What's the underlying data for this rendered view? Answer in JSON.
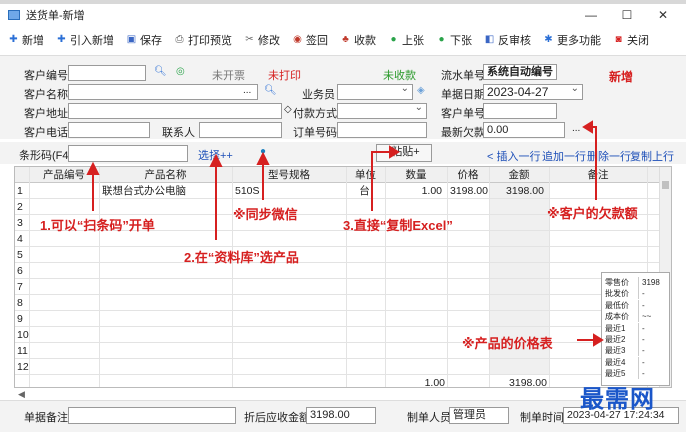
{
  "window": {
    "title": "送货单-新增"
  },
  "window_controls": {
    "minimize": "—",
    "maximize": "☐",
    "close": "✕"
  },
  "toolbar": [
    {
      "label": "新增",
      "icon": "plus-icon",
      "glyph": "✚",
      "color": "#2b6fd6"
    },
    {
      "label": "引入新增",
      "icon": "import-icon",
      "glyph": "✚",
      "color": "#2b6fd6"
    },
    {
      "label": "保存",
      "icon": "save-icon",
      "glyph": "▣",
      "color": "#3a66c4"
    },
    {
      "label": "打印预览",
      "icon": "printer-icon",
      "glyph": "⎙",
      "color": "#555"
    },
    {
      "label": "修改",
      "icon": "edit-icon",
      "glyph": "✂",
      "color": "#666"
    },
    {
      "label": "签回",
      "icon": "sign-back-icon",
      "glyph": "◉",
      "color": "#c0392b"
    },
    {
      "label": "收款",
      "icon": "money-icon",
      "glyph": "♣",
      "color": "#c0392b"
    },
    {
      "label": "上张",
      "icon": "prev-icon",
      "glyph": "●",
      "color": "#2aa34a"
    },
    {
      "label": "下张",
      "icon": "next-icon",
      "glyph": "●",
      "color": "#2aa34a"
    },
    {
      "label": "反审核",
      "icon": "unaudit-icon",
      "glyph": "◧",
      "color": "#3a66c4"
    },
    {
      "label": "更多功能",
      "icon": "more-icon",
      "glyph": "✱",
      "color": "#2b6fd6"
    },
    {
      "label": "关闭",
      "icon": "close-icon",
      "glyph": "◙",
      "color": "#d62020"
    }
  ],
  "form": {
    "customer_code": {
      "label": "客户编号",
      "value": ""
    },
    "customer_name": {
      "label": "客户名称",
      "value": ""
    },
    "customer_address": {
      "label": "客户地址",
      "value": ""
    },
    "customer_phone": {
      "label": "客户电话",
      "value": ""
    },
    "contact": {
      "label": "联系人",
      "value": ""
    },
    "salesperson": {
      "label": "业务员",
      "value": ""
    },
    "payment_method": {
      "label": "付款方式",
      "value": ""
    },
    "order_number": {
      "label": "订单号码",
      "value": ""
    },
    "serial_number": {
      "label": "流水单号",
      "value": "系统自动编号"
    },
    "document_date": {
      "label": "单据日期",
      "value": "2023-04-27"
    },
    "customer_doc_number": {
      "label": "客户单号",
      "value": ""
    },
    "latest_debt": {
      "label": "最新欠款",
      "value": "0.00"
    },
    "status_invoice": "未开票",
    "status_print": "未打印",
    "status_payment": "未收款",
    "mode_badge": "新增",
    "browse_button": "..."
  },
  "barcode": {
    "label": "条形码(F4)",
    "value": "",
    "select_link": "选择++",
    "paste_button": "粘贴+",
    "insert_row": "< 插入一行",
    "add_row": "追加一行",
    "delete_row": "删除一行",
    "copy_row": "复制上行"
  },
  "grid": {
    "columns": [
      "产品编号",
      "产品名称",
      "型号规格",
      "单位",
      "数量",
      "价格",
      "金额",
      "备注"
    ],
    "rows": [
      {
        "no": "1",
        "code": "",
        "name": "联想台式办公电脑",
        "model": "510S",
        "unit": "台",
        "qty": "1.00",
        "price": "3198.00",
        "amount": "3198.00",
        "note": ""
      },
      {
        "no": "2"
      },
      {
        "no": "3"
      },
      {
        "no": "4"
      },
      {
        "no": "5"
      },
      {
        "no": "6"
      },
      {
        "no": "7"
      },
      {
        "no": "8"
      },
      {
        "no": "9"
      },
      {
        "no": "10"
      },
      {
        "no": "11"
      },
      {
        "no": "12"
      }
    ],
    "total_qty": "1.00",
    "total_amount": "3198.00"
  },
  "price_panel": [
    {
      "k": "零售价",
      "v": "3198"
    },
    {
      "k": "批发价",
      "v": "-"
    },
    {
      "k": "最低价",
      "v": "-"
    },
    {
      "k": "成本价",
      "v": "~~"
    },
    {
      "k": "最近1",
      "v": "-"
    },
    {
      "k": "最近2",
      "v": "-"
    },
    {
      "k": "最近3",
      "v": "-"
    },
    {
      "k": "最近4",
      "v": "-"
    },
    {
      "k": "最近5",
      "v": "-"
    }
  ],
  "annotations": {
    "a1": "1.可以“扫条码”开单",
    "a2": "2.在“资料库”选产品",
    "a3": "3.直接“复制Excel”",
    "a4": "※同步微信",
    "a5": "※客户的欠款额",
    "a6": "※产品的价格表"
  },
  "footer": {
    "remark_label": "单据备注",
    "remark_value": "",
    "discounted_label": "折后应收金额",
    "discounted_value": "3198.00",
    "maker_label": "制单人员",
    "maker_value": "管理员",
    "time_label": "制单时间",
    "time_value": "2023-04-27 17:24:34"
  },
  "watermark": "最需网",
  "colors": {
    "annotation": "#d62020",
    "link": "#1d4fb8",
    "status_green": "#2a9a2a",
    "watermark": "#1a56c9"
  }
}
